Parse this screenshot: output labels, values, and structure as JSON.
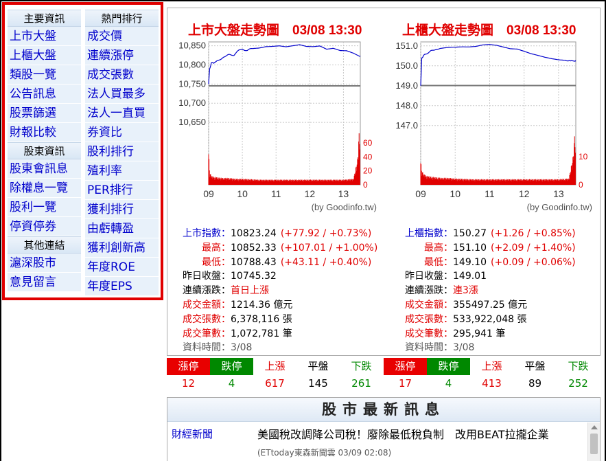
{
  "menu": {
    "left": [
      {
        "type": "head",
        "label": "主要資訊"
      },
      {
        "type": "item",
        "label": "上市大盤"
      },
      {
        "type": "item",
        "label": "上櫃大盤"
      },
      {
        "type": "item",
        "label": "類股一覽"
      },
      {
        "type": "item",
        "label": "公告訊息"
      },
      {
        "type": "item",
        "label": "股票篩選"
      },
      {
        "type": "item",
        "label": "財報比較"
      },
      {
        "type": "head",
        "label": "股東資訊"
      },
      {
        "type": "item",
        "label": "股東會訊息"
      },
      {
        "type": "item",
        "label": "除權息一覽"
      },
      {
        "type": "item",
        "label": "股利一覽"
      },
      {
        "type": "item",
        "label": "停資停券"
      },
      {
        "type": "head",
        "label": "其他連結"
      },
      {
        "type": "item",
        "label": "滬深股市"
      },
      {
        "type": "item",
        "label": "意見留言"
      }
    ],
    "right": [
      {
        "type": "head",
        "label": "熱門排行"
      },
      {
        "type": "item",
        "label": "成交價"
      },
      {
        "type": "item",
        "label": "連續漲停"
      },
      {
        "type": "item",
        "label": "成交張數"
      },
      {
        "type": "item",
        "label": "法人買最多"
      },
      {
        "type": "item",
        "label": "法人一直買"
      },
      {
        "type": "item",
        "label": "券資比"
      },
      {
        "type": "item",
        "label": "股利排行"
      },
      {
        "type": "item",
        "label": "殖利率"
      },
      {
        "type": "item",
        "label": "PER排行"
      },
      {
        "type": "item",
        "label": "獲利排行"
      },
      {
        "type": "item",
        "label": "由虧轉盈"
      },
      {
        "type": "item",
        "label": "獲利創新高"
      },
      {
        "type": "item",
        "label": "年度ROE"
      },
      {
        "type": "item",
        "label": "年度EPS"
      }
    ]
  },
  "twse": {
    "title": "上市大盤走勢圖　03/08 13:30",
    "credit": "(by Goodinfo.tw)",
    "stats": [
      {
        "label": "上市指數",
        "value": "10823.24",
        "change": "(+77.92 / +0.73%)",
        "label_color": "blue",
        "change_color": "red"
      },
      {
        "label": "最高",
        "value": "10852.33",
        "change": "(+107.01 / +1.00%)",
        "label_color": "red",
        "change_color": "red"
      },
      {
        "label": "最低",
        "value": "10788.43",
        "change": "(+43.11 / +0.40%)",
        "label_color": "red",
        "change_color": "red"
      },
      {
        "label": "昨日收盤",
        "value": "10745.32",
        "change": "",
        "label_color": "black",
        "change_color": "black"
      },
      {
        "label": "連續漲跌",
        "value": "首日上漲",
        "change": "",
        "label_color": "black",
        "change_color": "red",
        "value_color": "red"
      },
      {
        "label": "成交金額",
        "value": "1214.36 億元",
        "change": "",
        "label_color": "red",
        "change_color": "black"
      },
      {
        "label": "成交張數",
        "value": "6,378,116 張",
        "change": "",
        "label_color": "red",
        "change_color": "black"
      },
      {
        "label": "成交筆數",
        "value": "1,072,781 筆",
        "change": "",
        "label_color": "red",
        "change_color": "black"
      },
      {
        "label": "資料時間",
        "value": "3/08",
        "change": "",
        "label_color": "gray",
        "change_color": "black",
        "value_color": "gray"
      }
    ],
    "counts": {
      "limit_up": "12",
      "limit_down": "4",
      "up": "617",
      "flat": "145",
      "down": "261"
    }
  },
  "otc": {
    "title": "上櫃大盤走勢圖　03/08 13:30",
    "credit": "(by Goodinfo.tw)",
    "stats": [
      {
        "label": "上櫃指數",
        "value": "150.27",
        "change": "(+1.26 / +0.85%)",
        "label_color": "blue",
        "change_color": "red"
      },
      {
        "label": "最高",
        "value": "151.10",
        "change": "(+2.09 / +1.40%)",
        "label_color": "red",
        "change_color": "red"
      },
      {
        "label": "最低",
        "value": "149.10",
        "change": "(+0.09 / +0.06%)",
        "label_color": "red",
        "change_color": "red"
      },
      {
        "label": "昨日收盤",
        "value": "149.01",
        "change": "",
        "label_color": "black",
        "change_color": "black"
      },
      {
        "label": "連續漲跌",
        "value": "連3漲",
        "change": "",
        "label_color": "black",
        "change_color": "red",
        "value_color": "red"
      },
      {
        "label": "成交金額",
        "value": "355497.25 億元",
        "change": "",
        "label_color": "red",
        "change_color": "black"
      },
      {
        "label": "成交張數",
        "value": "533,922,048 張",
        "change": "",
        "label_color": "red",
        "change_color": "black"
      },
      {
        "label": "成交筆數",
        "value": "295,941 筆",
        "change": "",
        "label_color": "red",
        "change_color": "black"
      },
      {
        "label": "資料時間",
        "value": "3/08",
        "change": "",
        "label_color": "gray",
        "change_color": "black",
        "value_color": "gray"
      }
    ],
    "counts": {
      "limit_up": "17",
      "limit_down": "4",
      "up": "413",
      "flat": "89",
      "down": "252"
    }
  },
  "count_headers": {
    "limit_up": "漲停",
    "limit_down": "跌停",
    "up": "上漲",
    "flat": "平盤",
    "down": "下跌"
  },
  "colors": {
    "up": "#e00000",
    "down": "#008800",
    "link": "#0000cc",
    "line": "#0000cc",
    "menu_border": "#e00000"
  },
  "news": {
    "title": "股市最新訊息",
    "category": "財經新聞",
    "headline": "美國稅改調降公司稅！廢除最低稅負制　改用BEAT拉攏企業",
    "source": " (ETtoday東森新聞雲 03/09 02:08)"
  },
  "chart_data": [
    {
      "type": "line",
      "title": "上市大盤走勢圖　03/08 13:30",
      "x_ticks": [
        "09",
        "10",
        "11",
        "12",
        "13"
      ],
      "xlim": [
        9,
        13.5
      ],
      "y_ticks": [
        "10,850",
        "10,800",
        "10,750",
        "10,700",
        "10,650"
      ],
      "ylim": [
        10600,
        10860
      ],
      "reference": 10745.32,
      "series": [
        {
          "x": [
            9.0,
            9.03,
            9.08,
            9.15,
            9.25,
            9.35,
            9.45,
            9.6,
            9.75,
            9.9,
            10.0,
            10.15,
            10.3,
            10.5,
            10.7,
            10.9,
            11.1,
            11.3,
            11.5,
            11.7,
            11.9,
            12.1,
            12.3,
            12.5,
            12.7,
            12.9,
            13.1,
            13.3,
            13.5
          ],
          "y": [
            10750,
            10790,
            10805,
            10805,
            10812,
            10815,
            10822,
            10826,
            10826,
            10838,
            10840,
            10838,
            10843,
            10845,
            10849,
            10850,
            10851,
            10848,
            10850,
            10852,
            10847,
            10846,
            10848,
            10840,
            10843,
            10838,
            10838,
            10832,
            10823
          ]
        }
      ],
      "volume_ticks": [
        "60",
        "40",
        "20",
        "0"
      ],
      "volume_ylim": [
        0,
        65
      ],
      "volume": {
        "x": [
          9.0,
          9.03,
          9.1,
          9.2,
          9.4,
          9.6,
          9.8,
          10.0,
          10.5,
          11.0,
          11.5,
          12.0,
          12.5,
          13.0,
          13.3,
          13.42,
          13.46,
          13.5
        ],
        "y": [
          40,
          14,
          10,
          9,
          8,
          8,
          7,
          7,
          6,
          6,
          6,
          6,
          6,
          6,
          7,
          30,
          60,
          55
        ]
      },
      "credit": "(by Goodinfo.tw)"
    },
    {
      "type": "line",
      "title": "上櫃大盤走勢圖　03/08 13:30",
      "x_ticks": [
        "09",
        "10",
        "11",
        "12",
        "13"
      ],
      "xlim": [
        9,
        13.5
      ],
      "y_ticks": [
        "151.0",
        "150.0",
        "149.0",
        "148.0",
        "147.0"
      ],
      "ylim": [
        146.2,
        151.2
      ],
      "reference": 149.01,
      "series": [
        {
          "x": [
            9.0,
            9.03,
            9.08,
            9.15,
            9.3,
            9.45,
            9.6,
            9.8,
            10.0,
            10.2,
            10.4,
            10.6,
            10.8,
            11.0,
            11.2,
            11.4,
            11.6,
            11.8,
            12.0,
            12.2,
            12.4,
            12.6,
            12.8,
            13.0,
            13.2,
            13.35,
            13.5
          ],
          "y": [
            149.0,
            150.4,
            150.5,
            150.6,
            150.75,
            150.85,
            150.85,
            150.9,
            150.92,
            150.95,
            150.96,
            151.0,
            151.08,
            151.1,
            151.05,
            150.95,
            150.85,
            150.82,
            150.7,
            150.58,
            150.5,
            150.42,
            150.36,
            150.32,
            150.3,
            150.22,
            150.27
          ]
        }
      ],
      "volume_ticks": [
        "10",
        "0"
      ],
      "volume_ylim": [
        0,
        16
      ],
      "volume": {
        "x": [
          9.0,
          9.03,
          9.1,
          9.2,
          9.4,
          9.6,
          9.8,
          10.0,
          10.5,
          11.0,
          11.5,
          12.0,
          12.5,
          13.0,
          13.3,
          13.42,
          13.46,
          13.5
        ],
        "y": [
          7,
          4,
          3,
          2.5,
          2.2,
          2,
          2,
          1.8,
          1.6,
          1.6,
          1.6,
          1.6,
          1.6,
          1.6,
          1.8,
          8,
          14,
          12
        ]
      },
      "credit": "(by Goodinfo.tw)"
    }
  ]
}
